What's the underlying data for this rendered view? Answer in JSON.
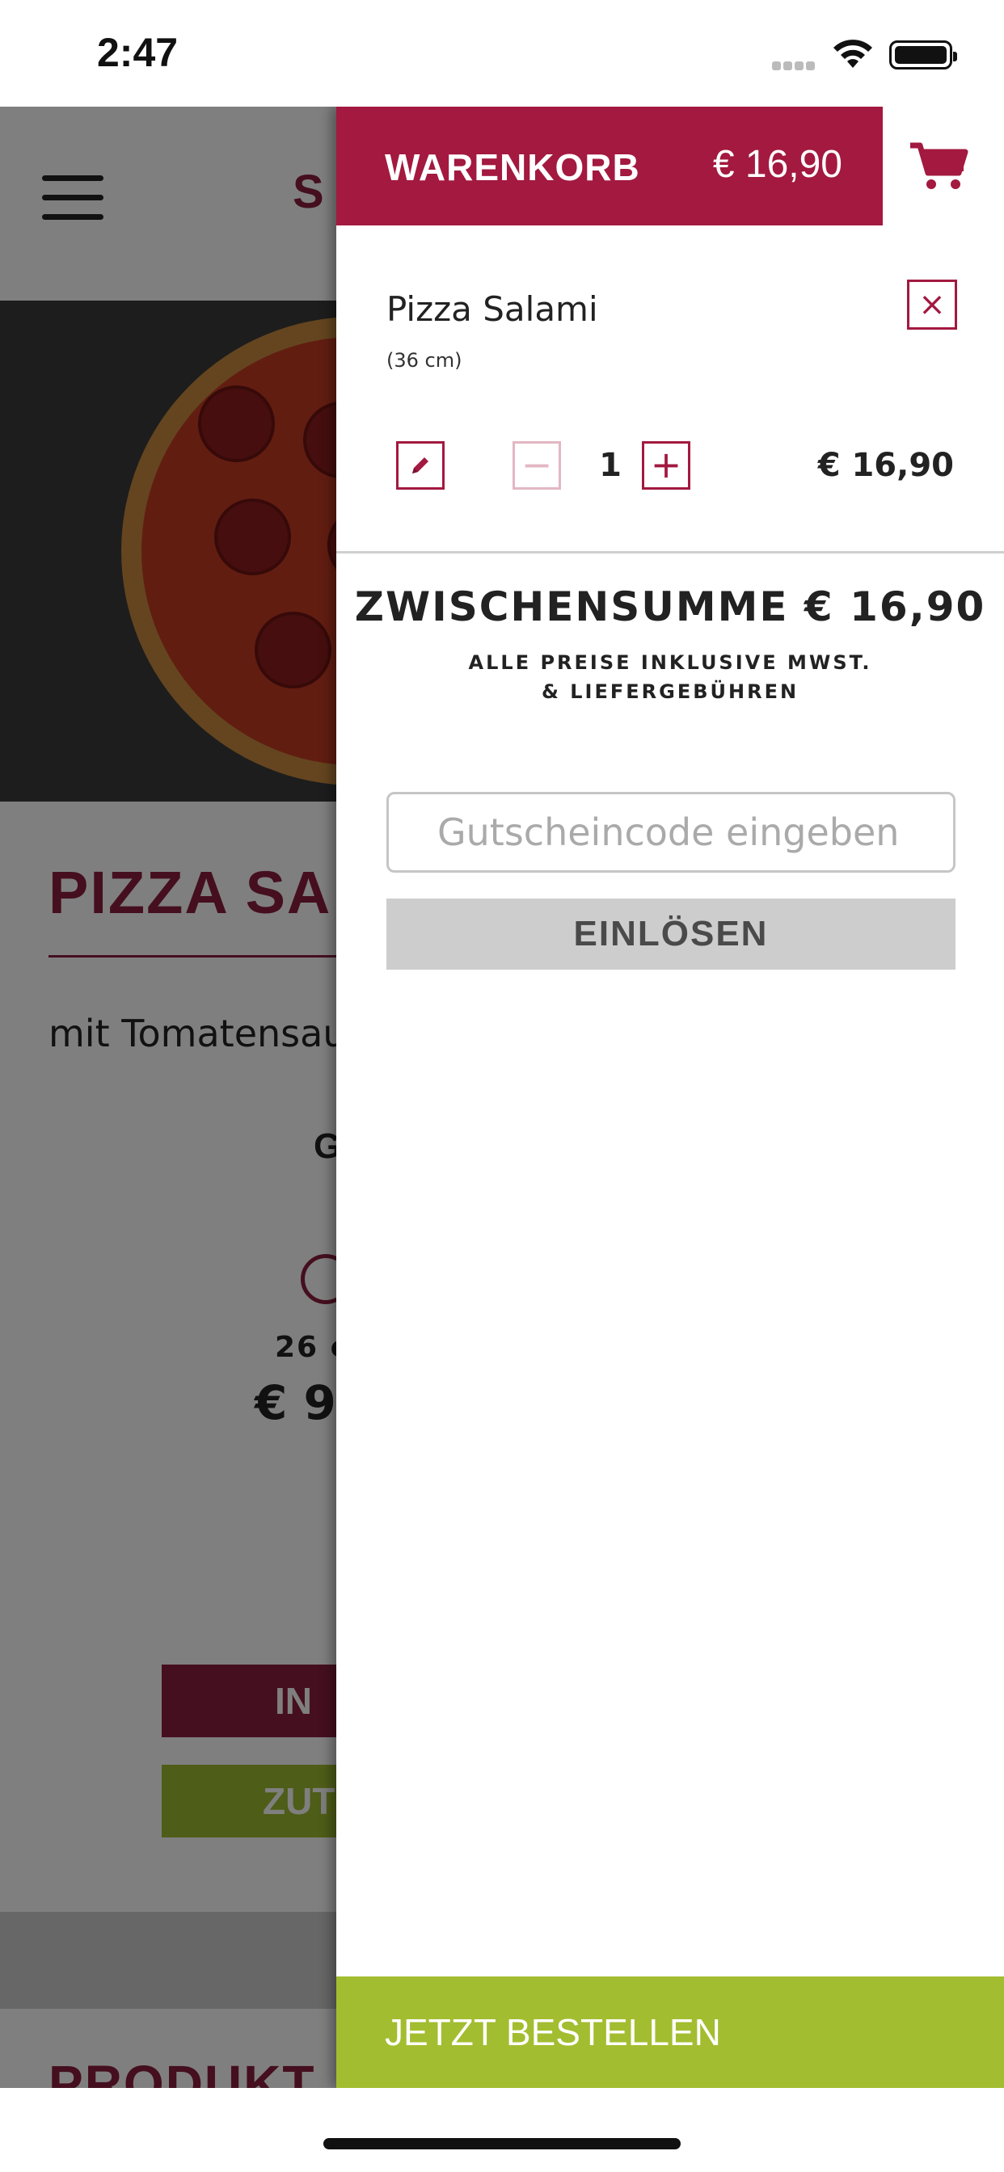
{
  "status_bar": {
    "time": "2:47"
  },
  "background_page": {
    "logo_text": "S",
    "product_title": "PIZZA SA",
    "description": "mit Tomatensau",
    "size_heading": "G",
    "size_option": "26 c",
    "price": "€ 9,",
    "add_to_cart_button": "IN",
    "back_button": "ZUT",
    "section_title": "PRODUKT"
  },
  "cart": {
    "title": "WARENKORB",
    "total": "€ 16,90",
    "cart_icon": "shopping-cart-icon",
    "item": {
      "name": "Pizza Salami",
      "size": "(36 cm)",
      "remove_icon": "×",
      "quantity": "1",
      "price": "€ 16,90"
    },
    "subtotal": "ZWISCHENSUMME € 16,90",
    "vat_note": "ALLE PREISE INKLUSIVE MWST. & LIEFERGEBÜHREN",
    "voucher_placeholder": "Gutscheincode eingeben",
    "redeem_button": "EINLÖSEN",
    "order_button": "JETZT BESTELLEN"
  },
  "colors": {
    "brand": "#a3193f",
    "accent_green": "#a3bd30",
    "disabled_gray": "#cdcdcd"
  }
}
